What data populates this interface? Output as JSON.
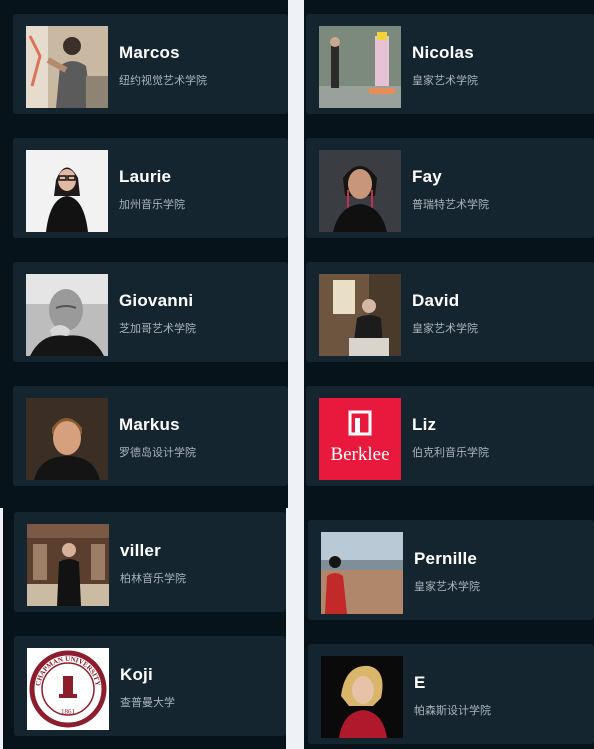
{
  "left_column": [
    {
      "name": "Marcos",
      "school": "纽约视觉艺术学院",
      "photo": "painter-photo"
    },
    {
      "name": "Laurie",
      "school": "加州音乐学院",
      "photo": "woman-glasses-photo"
    },
    {
      "name": "Giovanni",
      "school": "芝加哥艺术学院",
      "photo": "bw-portrait-photo"
    },
    {
      "name": "Markus",
      "school": "罗德岛设计学院",
      "photo": "man-portrait-photo"
    },
    {
      "name": "viller",
      "school": "柏林音乐学院",
      "photo": "conductor-photo"
    },
    {
      "name": "Koji",
      "school": "查普曼大学",
      "photo": "chapman-seal-logo",
      "logo_text": "CHAPMAN UNIVERSITY",
      "logo_year": "1861"
    }
  ],
  "right_column": [
    {
      "name": "Nicolas",
      "school": "皇家艺术学院",
      "photo": "street-art-photo"
    },
    {
      "name": "Fay",
      "school": "普瑞特艺术学院",
      "photo": "woman-dark-photo"
    },
    {
      "name": "David",
      "school": "皇家艺术学院",
      "photo": "seated-man-photo"
    },
    {
      "name": "Liz",
      "school": "伯克利音乐学院",
      "photo": "berklee-logo",
      "logo_text": "Berklee"
    },
    {
      "name": "Pernille",
      "school": "皇家艺术学院",
      "photo": "beach-photo"
    },
    {
      "name": "E",
      "school": "帕森斯设计学院",
      "photo": "blonde-woman-photo"
    }
  ],
  "colors": {
    "panel": "#07131b",
    "card": "#142530",
    "berklee": "#e8193c",
    "chapman": "#8c1d2c"
  }
}
